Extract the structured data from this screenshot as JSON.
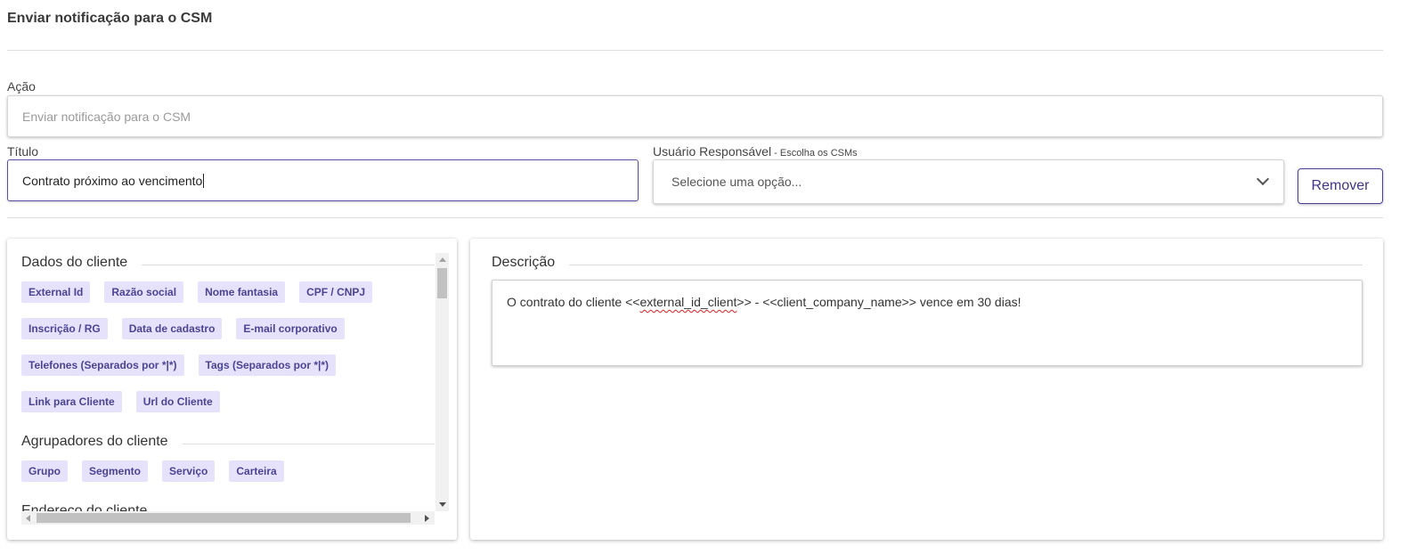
{
  "page": {
    "title": "Enviar notificação para o CSM"
  },
  "form": {
    "acao": {
      "label": "Ação",
      "value": "Enviar notificação para o CSM"
    },
    "titulo": {
      "label": "Título",
      "value": "Contrato próximo ao vencimento"
    },
    "usuario": {
      "label": "Usuário Responsável",
      "hint": " - Escolha os CSMs",
      "placeholder": "Selecione uma opção..."
    },
    "remove_label": "Remover"
  },
  "variables": {
    "sections": [
      {
        "title": "Dados do cliente",
        "chips": [
          "External Id",
          "Razão social",
          "Nome fantasia",
          "CPF / CNPJ",
          "Inscrição / RG",
          "Data de cadastro",
          "E-mail corporativo",
          "Telefones (Separados por *|*)",
          "Tags (Separados por *|*)",
          "Link para Cliente",
          "Url do Cliente"
        ]
      },
      {
        "title": "Agrupadores do cliente",
        "chips": [
          "Grupo",
          "Segmento",
          "Serviço",
          "Carteira"
        ]
      },
      {
        "title": "Endereço do cliente",
        "chips": []
      }
    ]
  },
  "description": {
    "title": "Descrição",
    "text_before": "O contrato do cliente <<",
    "text_flagged": "external_id_client",
    "text_after": ">> - <<client_company_name>> vence em 30 dias!"
  },
  "colors": {
    "accent": "#4a3f96",
    "chip_bg": "#e6e2fb",
    "chip_text": "#4b4494"
  }
}
